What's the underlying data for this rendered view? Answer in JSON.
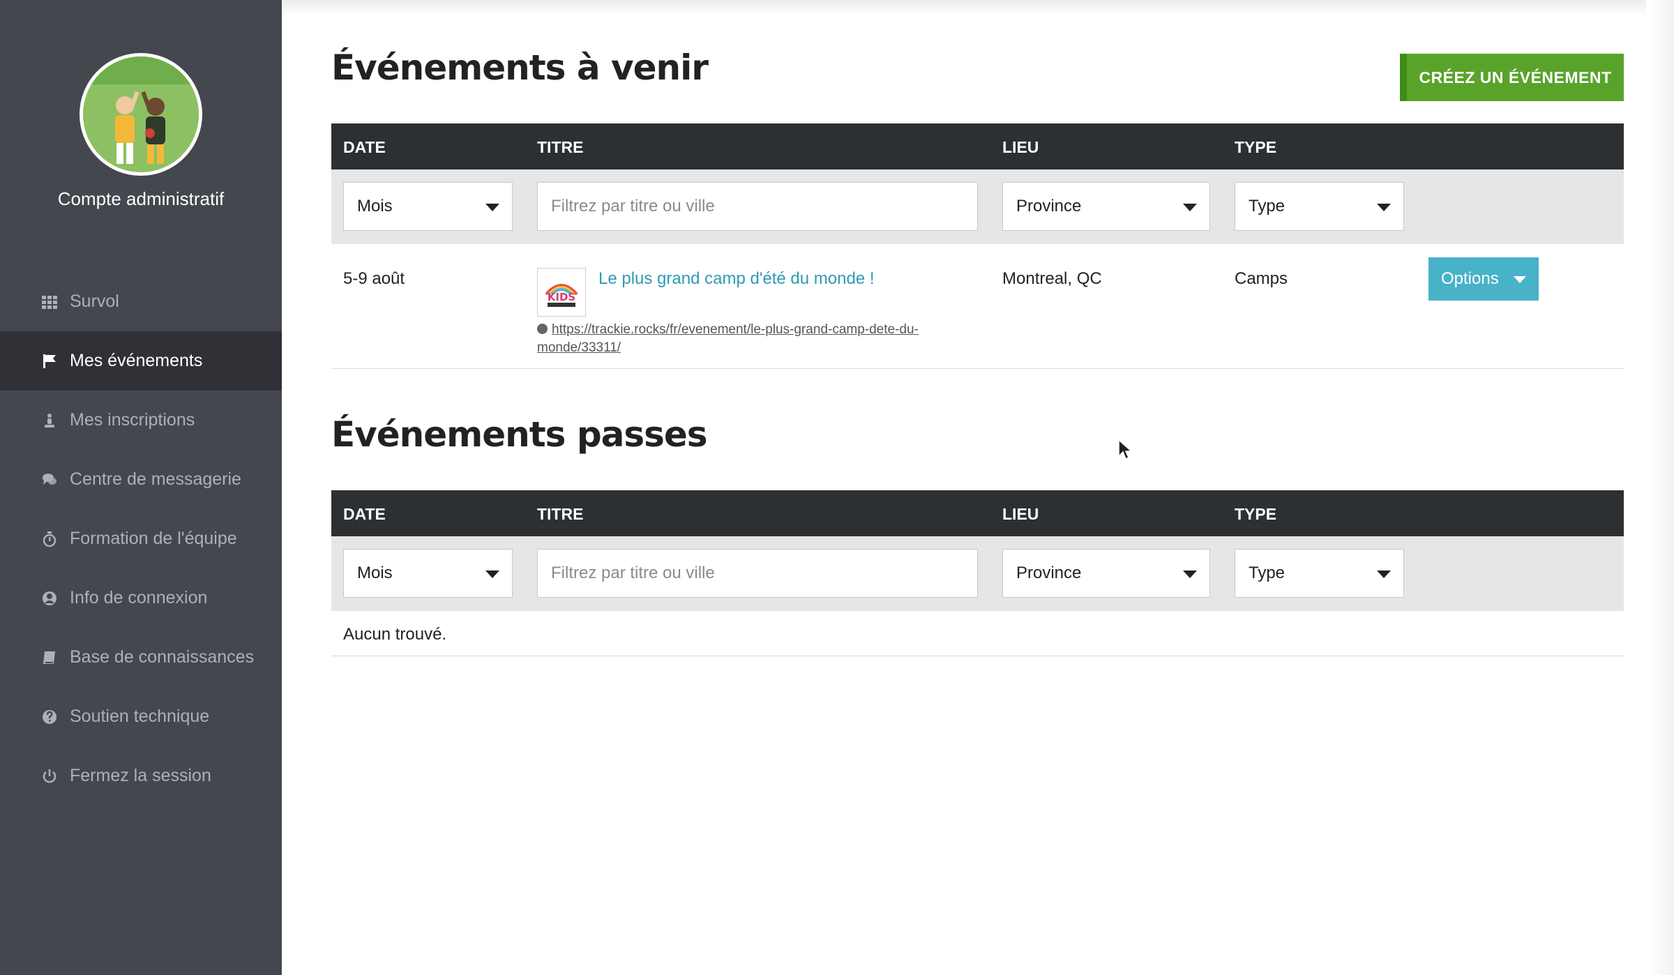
{
  "sidebar": {
    "account_name": "Compte administratif",
    "items": [
      {
        "label": "Survol",
        "icon": "grid-icon"
      },
      {
        "label": "Mes événements",
        "icon": "flag-icon",
        "active": true
      },
      {
        "label": "Mes inscriptions",
        "icon": "person-icon"
      },
      {
        "label": "Centre de messagerie",
        "icon": "chat-icon"
      },
      {
        "label": "Formation de l'équipe",
        "icon": "stopwatch-icon"
      },
      {
        "label": "Info de connexion",
        "icon": "user-circle-icon"
      },
      {
        "label": "Base de connaissances",
        "icon": "book-icon"
      },
      {
        "label": "Soutien technique",
        "icon": "question-circle-icon"
      },
      {
        "label": "Fermez la session",
        "icon": "power-icon"
      }
    ]
  },
  "upcoming": {
    "title": "Événements à venir",
    "create_button": "CRÉEZ UN ÉVÉNEMENT",
    "columns": [
      "DATE",
      "TITRE",
      "LIEU",
      "TYPE"
    ],
    "filters": {
      "month": "Mois",
      "search_placeholder": "Filtrez par titre ou ville",
      "province": "Province",
      "type": "Type"
    },
    "rows": [
      {
        "date": "5-9 août",
        "title": "Le plus grand camp d'été du monde !",
        "url": "https://trackie.rocks/fr/evenement/le-plus-grand-camp-dete-du-monde/33311/",
        "location": "Montreal, QC",
        "type": "Camps",
        "options_label": "Options"
      }
    ]
  },
  "past": {
    "title": "Événements passes",
    "columns": [
      "DATE",
      "TITRE",
      "LIEU",
      "TYPE"
    ],
    "filters": {
      "month": "Mois",
      "search_placeholder": "Filtrez par titre ou ville",
      "province": "Province",
      "type": "Type"
    },
    "empty_message": "Aucun trouvé."
  },
  "colors": {
    "sidebar_bg": "#45474f",
    "sidebar_active": "#2f3136",
    "table_header": "#2d3032",
    "create_button": "#59a32b",
    "options_button": "#48b2c8",
    "link": "#2f9bb5"
  }
}
